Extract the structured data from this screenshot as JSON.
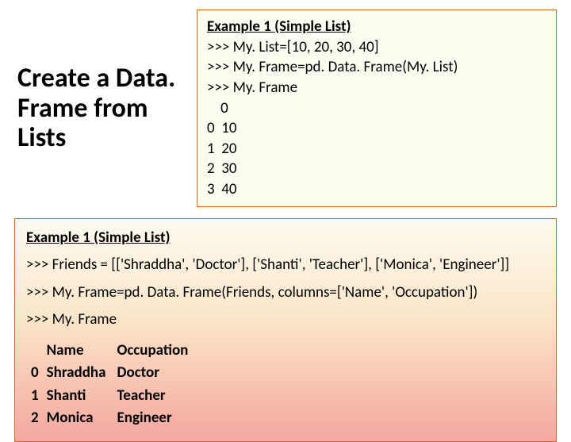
{
  "title": "Create a Data. Frame from Lists",
  "exampleTop": {
    "heading": "Example 1 (Simple List)",
    "lines": [
      ">>> My. List=[10, 20, 30, 40]",
      ">>> My. Frame=pd. Data. Frame(My. List)",
      ">>> My. Frame",
      "    0",
      "0  10",
      "1  20",
      "2  30",
      "3  40"
    ]
  },
  "exampleBottom": {
    "heading": "Example 1 (Simple List)",
    "lines": [
      ">>> Friends = [['Shraddha', 'Doctor'], ['Shanti', 'Teacher'], ['Monica', 'Engineer']]",
      ">>> My. Frame=pd. Data. Frame(Friends, columns=['Name', 'Occupation'])",
      ">>> My. Frame"
    ],
    "table": {
      "headers": [
        "",
        "Name",
        "Occupation"
      ],
      "rows": [
        [
          "0",
          "Shraddha",
          "Doctor"
        ],
        [
          "1",
          "Shanti",
          "Teacher"
        ],
        [
          "2",
          "Monica",
          "Engineer"
        ]
      ]
    }
  }
}
